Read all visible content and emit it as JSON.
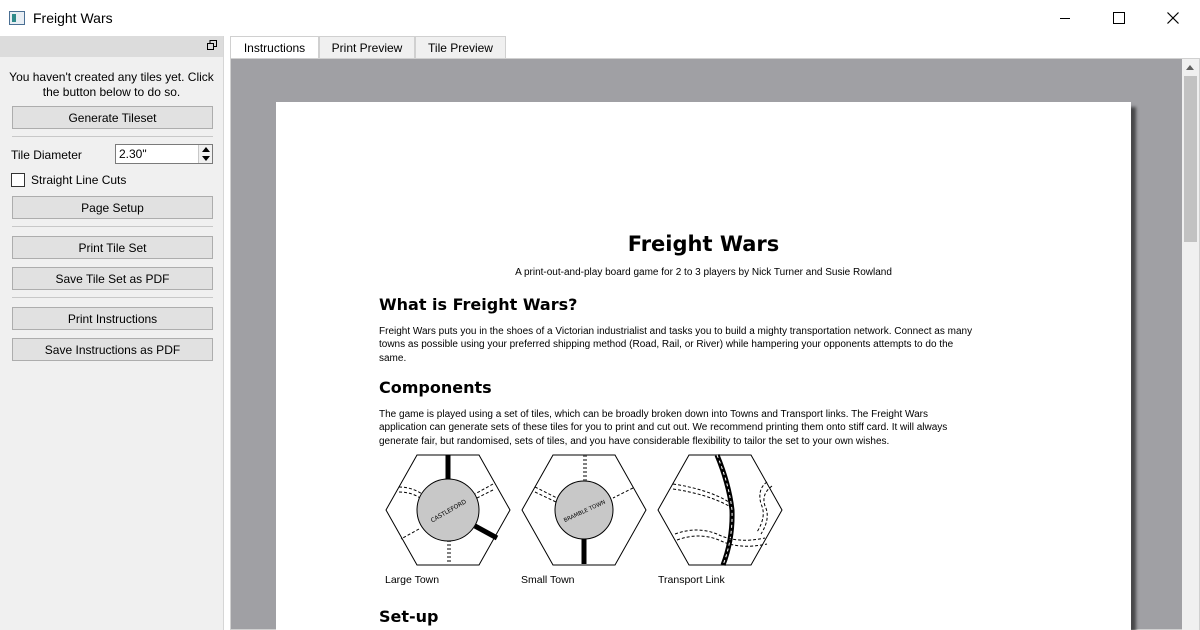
{
  "window": {
    "title": "Freight Wars"
  },
  "sidebar": {
    "info_text": "You haven't created any tiles yet. Click the button below to do so.",
    "generate_button": "Generate Tileset",
    "tile_diameter_label": "Tile Diameter",
    "tile_diameter_value": "2.30\"",
    "straight_cuts_label": "Straight Line Cuts",
    "straight_cuts_checked": false,
    "page_setup_button": "Page Setup",
    "print_tiles_button": "Print Tile Set",
    "save_tiles_pdf_button": "Save Tile Set as PDF",
    "print_instructions_button": "Print Instructions",
    "save_instructions_pdf_button": "Save Instructions as PDF"
  },
  "tabs": [
    {
      "label": "Instructions",
      "active": true
    },
    {
      "label": "Print Preview",
      "active": false
    },
    {
      "label": "Tile Preview",
      "active": false
    }
  ],
  "document": {
    "title": "Freight Wars",
    "subtitle": "A print-out-and-play board game for 2 to 3 players by Nick Turner and Susie Rowland",
    "section1_heading": "What is Freight Wars?",
    "section1_line1": "Freight Wars puts you in the shoes of a Victorian industrialist and tasks you to build a mighty transportation network. Connect as many",
    "section1_line2": "towns as possible using your preferred shipping method (Road, Rail, or River) while hampering your opponents attempts to do the",
    "section1_line3": "same.",
    "section2_heading": "Components",
    "section2_line1": "The game is played using a set of tiles, which can be broadly broken down into Towns and Transport links. The Freight Wars",
    "section2_line2": "application can generate sets of these tiles for you to print and cut out. We recommend printing them onto stiff card. It will always",
    "section2_line3": "generate fair, but randomised, sets of tiles, and you have considerable flexibility to tailor the set to your own wishes.",
    "tiles": [
      {
        "caption": "Large Town",
        "town_name": "CASTLEFORD"
      },
      {
        "caption": "Small Town",
        "town_name": "BRAMBLE TOWN"
      },
      {
        "caption": "Transport Link"
      }
    ],
    "section3_heading": "Set-up"
  }
}
